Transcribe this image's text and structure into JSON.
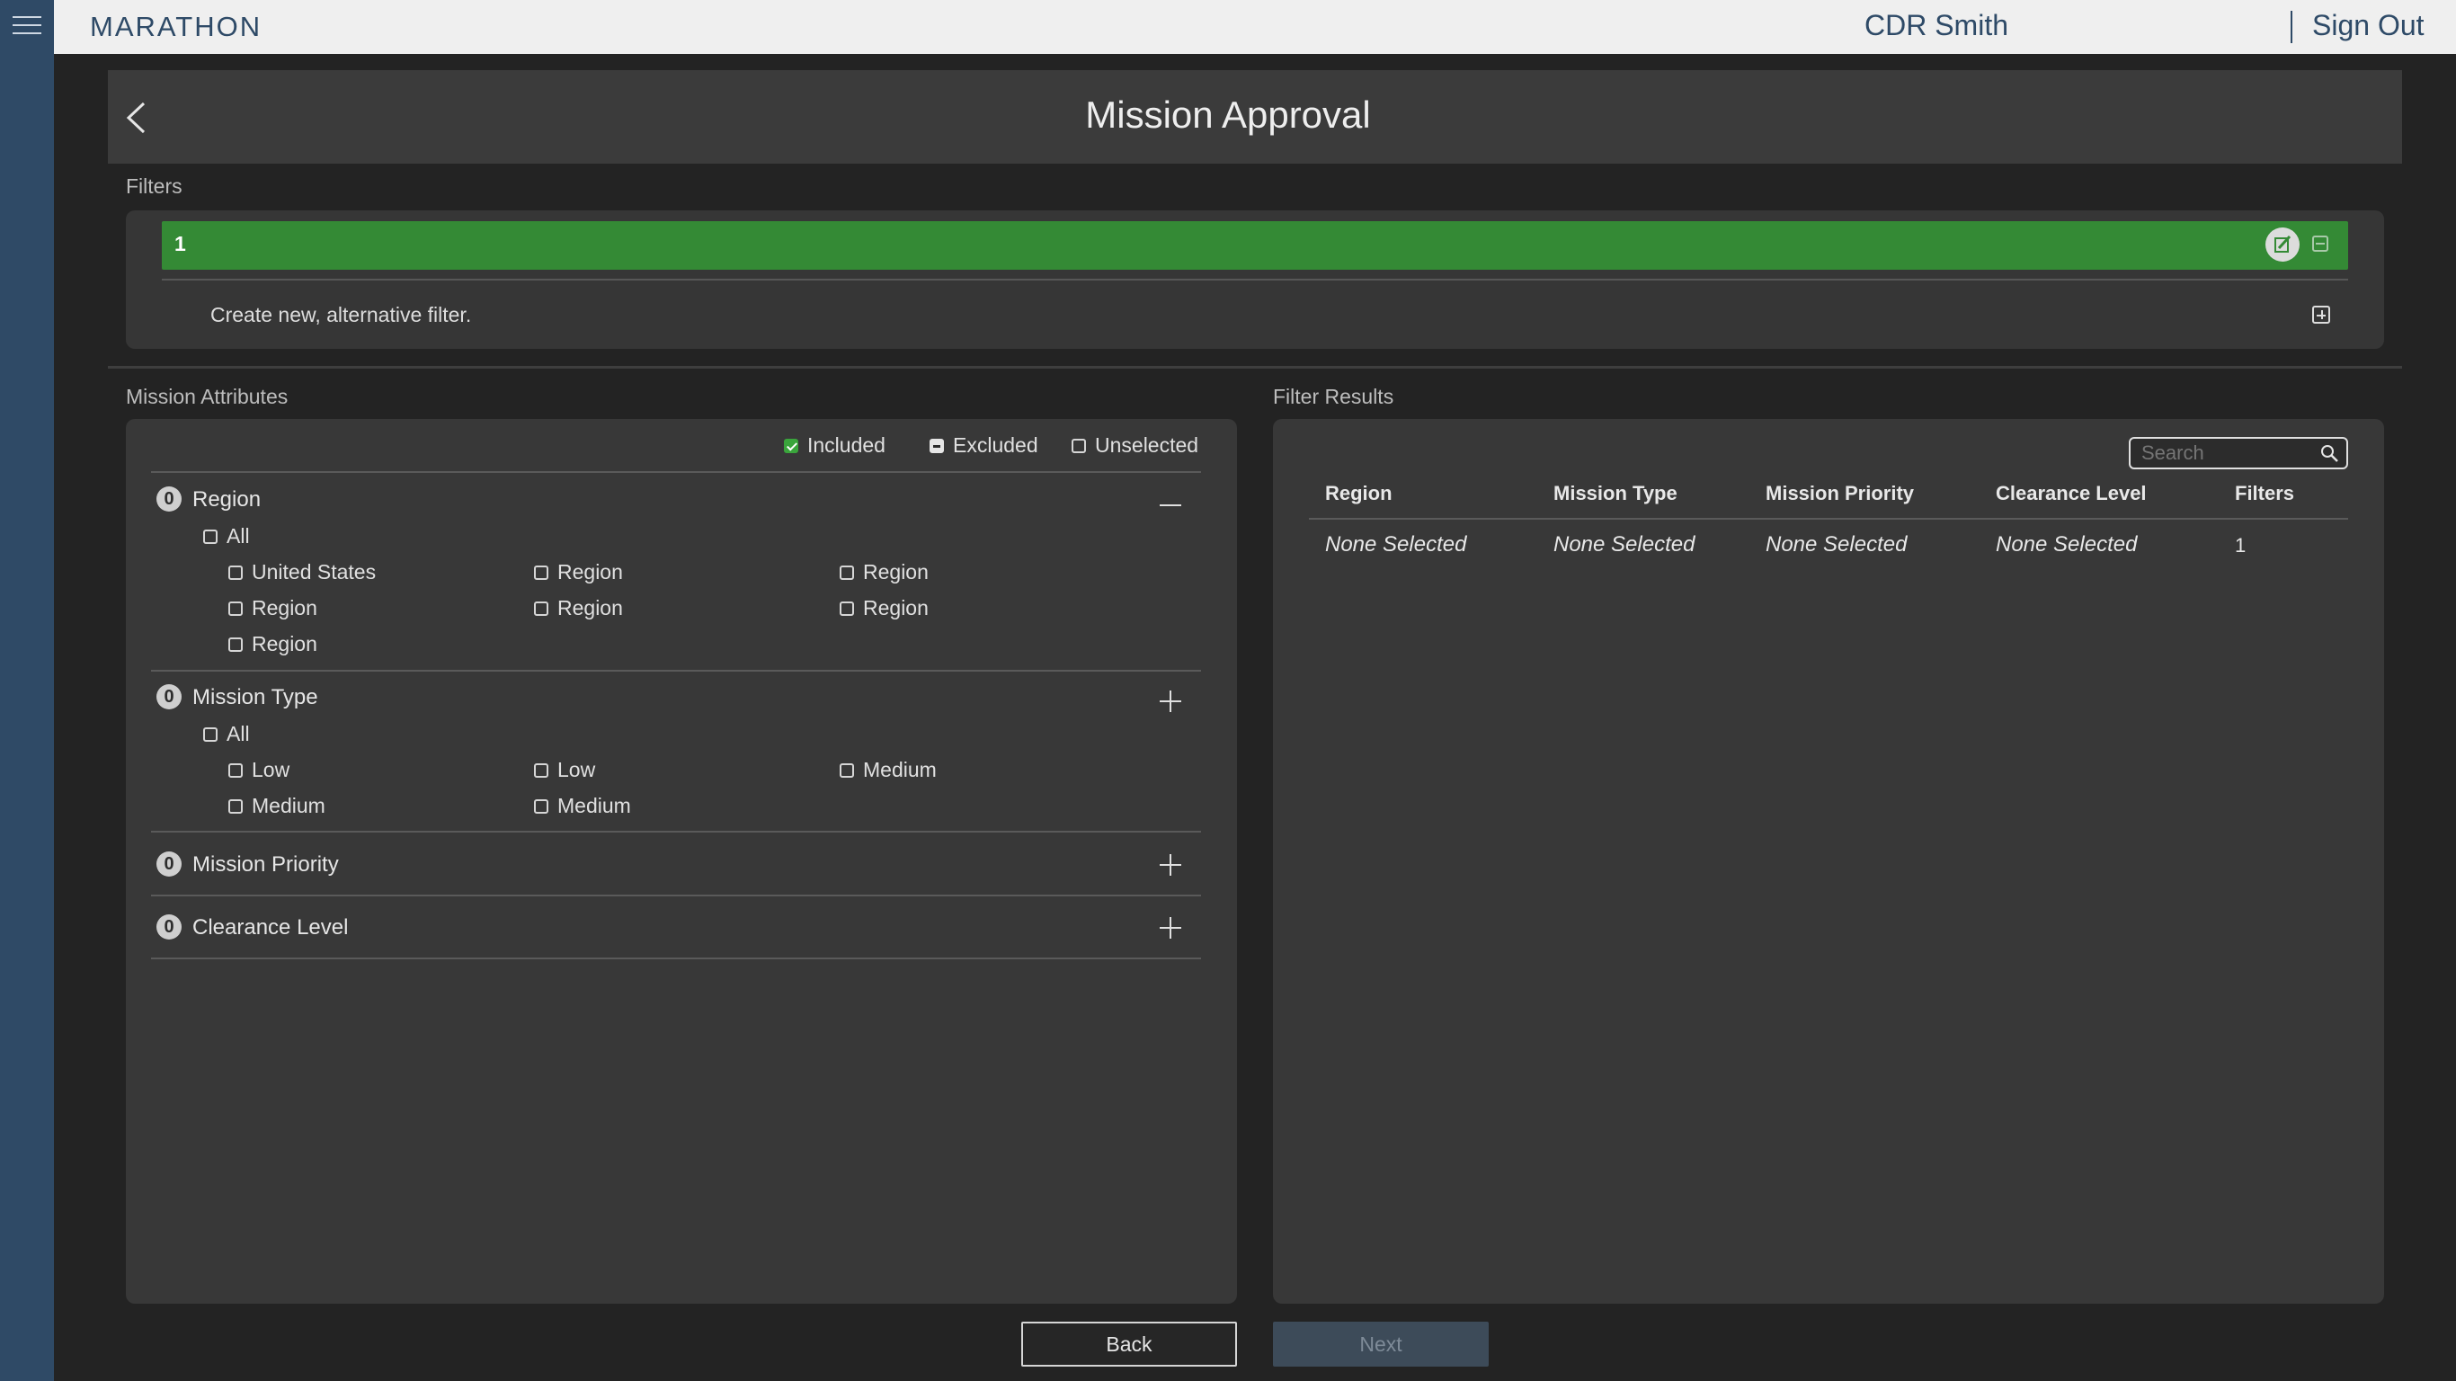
{
  "app": {
    "brand": "MARATHON"
  },
  "topbar": {
    "user": "CDR Smith",
    "sign_out": "Sign Out"
  },
  "page": {
    "title": "Mission Approval"
  },
  "filters": {
    "section_label": "Filters",
    "items": [
      {
        "name": "1"
      }
    ],
    "create_text": "Create new, alternative filter."
  },
  "attributes": {
    "section_label": "Mission Attributes",
    "legend": {
      "included": "Included",
      "excluded": "Excluded",
      "unselected": "Unselected"
    },
    "groups": [
      {
        "count": "0",
        "title": "Region",
        "expanded": true,
        "all_label": "All",
        "options": [
          "United States",
          "Region",
          "Region",
          "Region",
          "Region",
          "Region",
          "Region"
        ]
      },
      {
        "count": "0",
        "title": "Mission Type",
        "expanded": true,
        "all_label": "All",
        "options": [
          "Low",
          "Low",
          "Medium",
          "Medium",
          "Medium"
        ]
      },
      {
        "count": "0",
        "title": "Mission Priority",
        "expanded": false
      },
      {
        "count": "0",
        "title": "Clearance Level",
        "expanded": false
      }
    ]
  },
  "results": {
    "section_label": "Filter Results",
    "search_placeholder": "Search",
    "columns": [
      "Region",
      "Mission Type",
      "Mission Priority",
      "Clearance Level",
      "Filters"
    ],
    "rows": [
      [
        "None Selected",
        "None Selected",
        "None Selected",
        "None Selected",
        "1"
      ]
    ]
  },
  "buttons": {
    "back": "Back",
    "next": "Next"
  },
  "colors": {
    "rail": "#2f4a66",
    "filter_active": "#348a35",
    "included": "#3aa53c",
    "next_disabled": "#3d4b59"
  }
}
